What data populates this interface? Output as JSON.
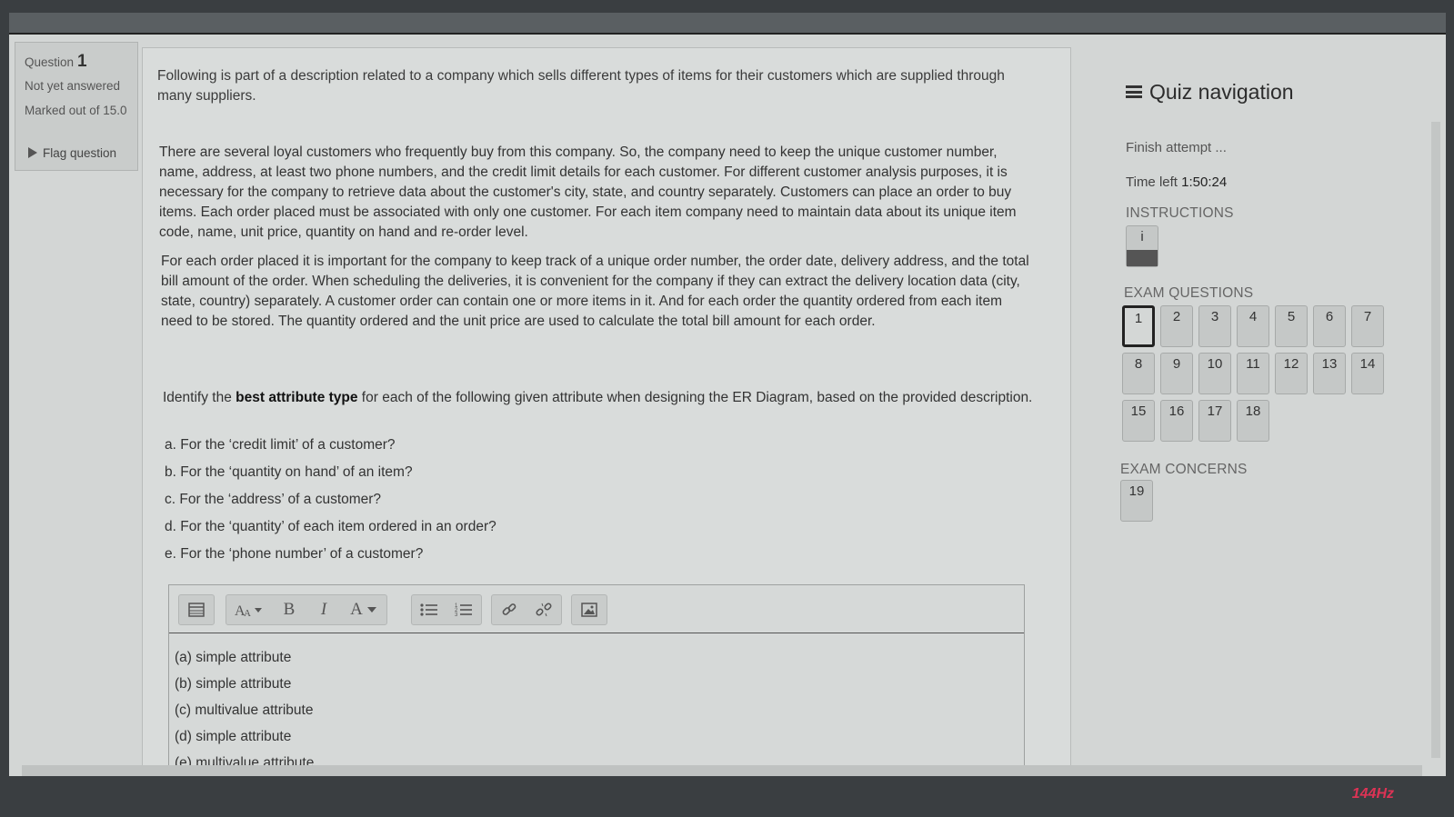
{
  "question": {
    "label": "Question",
    "number": "1",
    "state": "Not yet answered",
    "marks": "Marked out of 15.0",
    "flag_label": "Flag question"
  },
  "content": {
    "intro": "Following is part of a description related to a company which sells different types of items for their customers which are supplied through many suppliers.",
    "desc1": "There are several loyal customers who frequently buy from this company. So, the company need to keep the unique customer number, name, address, at least two phone numbers, and the credit limit details for each customer. For different customer analysis purposes, it is necessary for the company to retrieve data about the customer's city, state, and country separately. Customers can place an order to buy items. Each order placed must be associated with only one customer. For each item company need to maintain data about its unique item code, name, unit price, quantity on hand and re-order level.",
    "desc2": "For each order placed it is important for the company to keep track of a unique order number, the order date, delivery address, and the total bill amount of the order. When scheduling the deliveries, it is convenient for the company if they can extract the delivery location data (city, state, country) separately. A customer order can contain one or more items in it. And for each order the quantity ordered from each item need to be stored. The quantity ordered and the unit price are used to calculate the total bill amount for each order.",
    "identify_pre": "Identify the ",
    "identify_bold": "best attribute type",
    "identify_post": " for each of the following given attribute when designing the ER Diagram, based on the provided description.",
    "questions": [
      "a. For the ‘credit limit’ of a customer?",
      "b. For the ‘quantity on hand’ of an item?",
      "c. For the ‘address’ of a customer?",
      "d. For the ‘quantity’ of each item ordered in an order?",
      "e. For the ‘phone number’ of a customer?"
    ]
  },
  "editor": {
    "toolbar": {
      "bold": "B",
      "italic": "I",
      "font_color": "A"
    },
    "answers": [
      "(a) simple attribute",
      "(b) simple attribute",
      "(c) multivalue attribute",
      "(d) simple attribute",
      "(e) multivalue attribute"
    ]
  },
  "nav": {
    "title": "Quiz navigation",
    "finish": "Finish attempt ...",
    "time_label": "Time left ",
    "time_value": "1:50:24",
    "instructions_heading": "INSTRUCTIONS",
    "instructions_btn": "i",
    "exam_questions_heading": "EXAM QUESTIONS",
    "exam_questions": [
      "1",
      "2",
      "3",
      "4",
      "5",
      "6",
      "7",
      "8",
      "9",
      "10",
      "11",
      "12",
      "13",
      "14",
      "15",
      "16",
      "17",
      "18"
    ],
    "current_question": "1",
    "concerns_heading": "EXAM CONCERNS",
    "concerns": [
      "19"
    ]
  },
  "monitor_badge": "144Hz",
  "icons": [
    "flag-icon",
    "hamburger-icon",
    "source-icon",
    "font-size-icon",
    "bold-icon",
    "italic-icon",
    "font-color-icon",
    "bullet-list-icon",
    "numbered-list-icon",
    "link-icon",
    "unlink-icon",
    "image-icon"
  ]
}
